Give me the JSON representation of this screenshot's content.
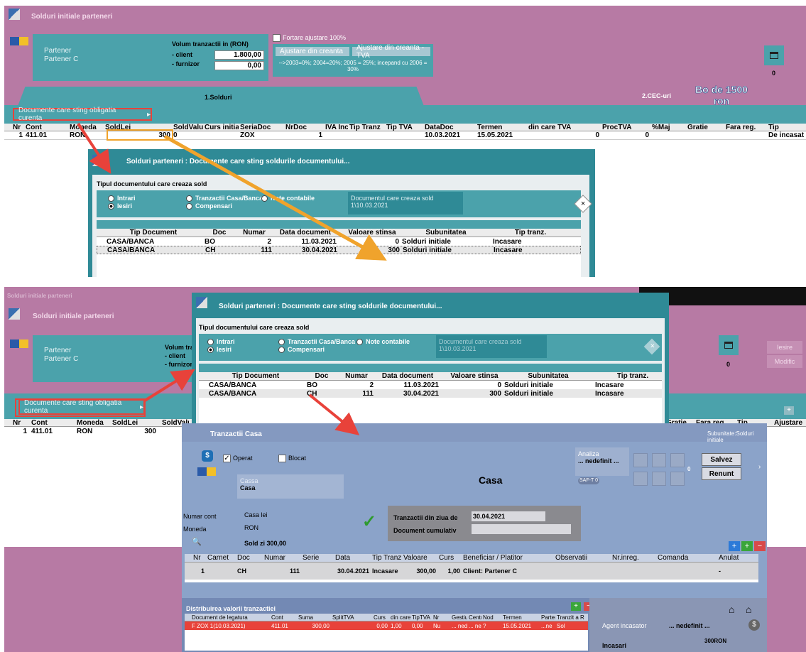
{
  "top": {
    "window_title": "Solduri initiale parteneri",
    "partner_label1": "Partener",
    "partner_label2": "Partener C",
    "volum_title": "Volum tranzactii in (RON)",
    "client_label": "- client",
    "client_value": "1.800,00",
    "furnizor_label": "- furnizor",
    "furnizor_value": "0,00",
    "fortare": "Fortare ajustare 100%",
    "ajust1": "Ajustare din creanta",
    "ajust2": "Ajustare din creanta -TVA",
    "note_text": "-->2003=0%; 2004=20%; 2005 = 25%; incepand cu 2006 = 30%",
    "count": "0",
    "tab1": "1.Solduri",
    "tab2": "2.CEC-uri",
    "annotation": "Bo de 1500 ron",
    "doc_btn": "Documente care sting obligatia curenta",
    "headers": [
      "Nr",
      "Cont",
      "Moneda",
      "SoldLei",
      "SoldValuta",
      "Curs initial",
      "SeriaDoc",
      "NrDoc",
      "IVA Incas",
      "Tip Tranz",
      "Tip TVA",
      "DataDoc",
      "Termen",
      "din care TVA",
      "ProcTVA",
      "%Maj",
      "Gratie",
      "Fara reg.",
      "Tip"
    ],
    "row": [
      "1",
      "411.01",
      "RON",
      "300",
      "0",
      "",
      "ZOX",
      "1",
      "",
      "",
      "",
      "10.03.2021",
      "15.05.2021",
      "0",
      "0",
      "",
      "",
      "",
      "De incasat"
    ]
  },
  "dialog1": {
    "title": "Solduri parteneri : Documente care sting soldurile documentului...",
    "section": "Tipul documentului care creaza sold",
    "opt_intrari": "Intrari",
    "opt_iesiri": "Iesiri",
    "opt_casa": "Tranzactii Casa/Banca",
    "opt_comp": "Compensari",
    "opt_note": "Note contabile",
    "doc_label": "Documentul care creaza sold",
    "doc_value": "1\\10.03.2021",
    "headers": [
      "Tip Document",
      "Doc",
      "Numar",
      "Data document",
      "Valoare stinsa",
      "Subunitatea",
      "Tip tranz."
    ],
    "rows": [
      [
        "CASA/BANCA",
        "BO",
        "2",
        "11.03.2021",
        "0",
        "Solduri initiale",
        "Incasare"
      ],
      [
        "CASA/BANCA",
        "CH",
        "111",
        "30.04.2021",
        "300",
        "Solduri initiale",
        "Incasare"
      ]
    ]
  },
  "bottom": {
    "window_title": "Solduri initiale parteneri",
    "partner_label1": "Partener",
    "partner_label2": "Partener C",
    "volum_tr": "Volum tra",
    "client_label": "- client",
    "furnizor_label": "- furnizor",
    "count": "0",
    "btn_iesire": "Iesire",
    "btn_modific": "Modific",
    "doc_btn": "Documente care sting obligatia curenta",
    "headers": [
      "Nr",
      "Cont",
      "Moneda",
      "SoldLei",
      "SoldValuta"
    ],
    "row": [
      "1",
      "411.01",
      "RON",
      "300",
      ""
    ],
    "right_headers": [
      "Gratie",
      "Fara reg.",
      "Tip",
      "Ajustare"
    ]
  },
  "dialog2": {
    "title": "Solduri parteneri : Documente care sting soldurile documentului...",
    "section": "Tipul documentului care creaza sold",
    "opt_intrari": "Intrari",
    "opt_iesiri": "Iesiri",
    "opt_casa": "Tranzactii Casa/Banca",
    "opt_comp": "Compensari",
    "opt_note": "Note contabile",
    "doc_label": "Documentul care creaza sold",
    "doc_value": "1\\10.03.2021",
    "headers": [
      "Tip Document",
      "Doc",
      "Numar",
      "Data document",
      "Valoare stinsa",
      "Subunitatea",
      "Tip tranz."
    ],
    "rows": [
      [
        "CASA/BANCA",
        "BO",
        "2",
        "11.03.2021",
        "0",
        "Solduri initiale",
        "Incasare"
      ],
      [
        "CASA/BANCA",
        "CH",
        "111",
        "30.04.2021",
        "300",
        "Solduri initiale",
        "Incasare"
      ]
    ]
  },
  "casa": {
    "title": "Tranzactii Casa",
    "subunitate": "Subunitate:Solduri initiale",
    "operat": "Operat",
    "blocat": "Blocat",
    "cassa_label": "Cassa",
    "cassa_value": "Casa",
    "heading": "Casa",
    "analiza_label": "Analiza",
    "analiza_value": "... nedefinit ...",
    "saft": "SAF-T",
    "saft_count": "0",
    "side_count": "0",
    "salvez": "Salvez",
    "renunt": "Renunt",
    "numar_cont_label": "Numar cont",
    "numar_cont_value": "Casa lei",
    "moneda_label": "Moneda",
    "moneda_value": "RON",
    "sold": "Sold zi 300,00",
    "tranz_label": "Tranzactii din ziua de",
    "tranz_value": "30.04.2021",
    "cumulativ_label": "Document cumulativ",
    "grid_headers": [
      "Nr",
      "Carnet",
      "Doc",
      "Numar",
      "Serie",
      "Data",
      "Tip Tranz",
      "Valoare",
      "Curs",
      "Beneficiar / Platitor",
      "Observatii",
      "Nr.inreg.",
      "Comanda",
      "Anulat"
    ],
    "grid_row": [
      "1",
      "",
      "CH",
      "111",
      "",
      "30.04.2021",
      "Incasare",
      "300,00",
      "1,00",
      "Client: Partener C",
      "",
      "",
      "",
      "-"
    ],
    "distrib_title": "Distribuirea valorii tranzactiei",
    "distrib_headers": [
      "Document de legatura",
      "Cont",
      "Suma",
      "SplitTVA",
      "Curs",
      "din care TVA",
      "TipTVA",
      "Nr",
      "Gestiune",
      "Centru",
      "Nod",
      "Termen",
      "Partener",
      "Tranzit a R"
    ],
    "distrib_row": [
      "F ZOX 1(10.03.2021)",
      "411.01",
      "300,00",
      "",
      "0,00",
      "1,00",
      "0,00",
      "Nu",
      "... nedi",
      "... nec",
      "?",
      "15.05.2021",
      "...ne",
      "Sol"
    ],
    "agent_label": "Agent incasator",
    "agent_value": "... nedefinit ...",
    "incasari": "Incasari",
    "incasari_value": "300RON"
  }
}
